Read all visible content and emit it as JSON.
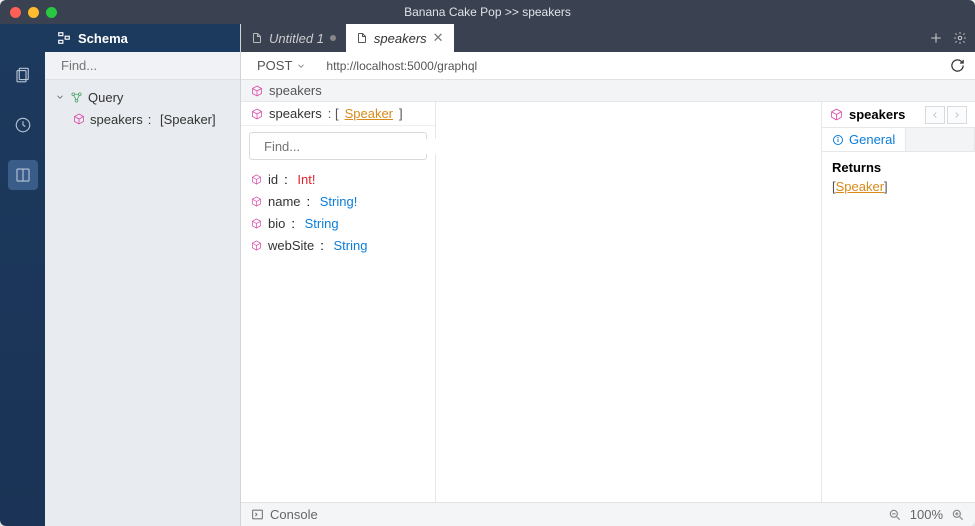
{
  "window": {
    "title": "Banana Cake Pop >> speakers"
  },
  "rail": {
    "items": [
      "documents",
      "history",
      "reference"
    ]
  },
  "schemaTab": {
    "label": "Schema"
  },
  "tabs": [
    {
      "label": "Untitled 1",
      "dirty": true
    },
    {
      "label": "speakers",
      "active": true
    }
  ],
  "leftFind": {
    "placeholder": "Find..."
  },
  "tree": {
    "root": {
      "label": "Query"
    },
    "items": [
      {
        "name": "speakers",
        "type": "[Speaker]"
      }
    ]
  },
  "request": {
    "method": "POST",
    "url": "http://localhost:5000/graphql"
  },
  "breadcrumb": {
    "label": "speakers"
  },
  "detail": {
    "header": {
      "name": "speakers",
      "typeLink": "Speaker"
    },
    "find": {
      "placeholder": "Find..."
    },
    "fields": [
      {
        "name": "id",
        "type": "Int!",
        "required": true
      },
      {
        "name": "name",
        "type": "String!",
        "required": true
      },
      {
        "name": "bio",
        "type": "String",
        "required": false
      },
      {
        "name": "webSite",
        "type": "String",
        "required": false
      }
    ]
  },
  "inspector": {
    "title": "speakers",
    "tab": "General",
    "returnsLabel": "Returns",
    "returnsType": "Speaker"
  },
  "status": {
    "console": "Console",
    "zoom": "100%"
  }
}
